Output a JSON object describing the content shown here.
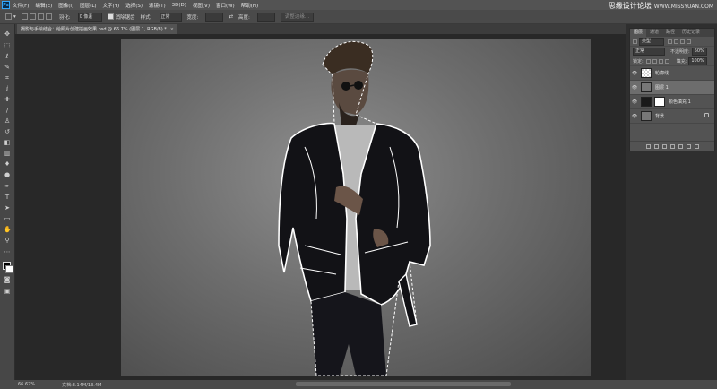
{
  "app": {
    "logo": "Ps"
  },
  "menu": [
    "文件(F)",
    "编辑(E)",
    "图像(I)",
    "图层(L)",
    "文字(Y)",
    "选择(S)",
    "滤镜(T)",
    "3D(D)",
    "视图(V)",
    "窗口(W)",
    "帮助(H)"
  ],
  "watermark": {
    "title": "思缘设计论坛",
    "site": "WWW.MISSYUAN.COM"
  },
  "options": {
    "feather_label": "羽化:",
    "feather_value": "0 像素",
    "antialias_label": "消除锯齿",
    "style_label": "样式:",
    "style_value": "正常",
    "width_label": "宽度:",
    "height_label": "高度:",
    "refine_button": "调整边缘..."
  },
  "document_tab": {
    "title": "摄影与手绘结合：给照片创建插画效果.psd @ 66.7% (图层 1, RGB/8) *",
    "close": "×"
  },
  "tools": [
    "move-tool",
    "marquee-tool",
    "lasso-tool",
    "quick-select-tool",
    "crop-tool",
    "eyedropper-tool",
    "healing-tool",
    "brush-tool",
    "stamp-tool",
    "history-brush-tool",
    "eraser-tool",
    "gradient-tool",
    "blur-tool",
    "dodge-tool",
    "pen-tool",
    "type-tool",
    "path-select-tool",
    "shape-tool",
    "hand-tool",
    "zoom-tool"
  ],
  "status": {
    "zoom": "66.67%",
    "doc_info": "文档:3.14M/13.4M"
  },
  "layers_panel": {
    "tabs": [
      "图层",
      "通道",
      "路径",
      "历史记录"
    ],
    "kind_label": "类型",
    "blend_mode": "正常",
    "opacity_label": "不透明度:",
    "opacity_value": "50%",
    "lock_label": "锁定:",
    "fill_label": "填充:",
    "fill_value": "100%",
    "layers": [
      {
        "name": "轮廓线",
        "visible": true,
        "selected": false
      },
      {
        "name": "图层 1",
        "visible": true,
        "selected": true
      },
      {
        "name": "颜色填充 1",
        "visible": true,
        "selected": false
      },
      {
        "name": "背景",
        "visible": true,
        "selected": false
      }
    ]
  },
  "colors": {
    "accent": "#31a8ff",
    "ui_dark": "#282828",
    "ui_panel": "#535353",
    "selected_layer": "#6d6d6d"
  }
}
